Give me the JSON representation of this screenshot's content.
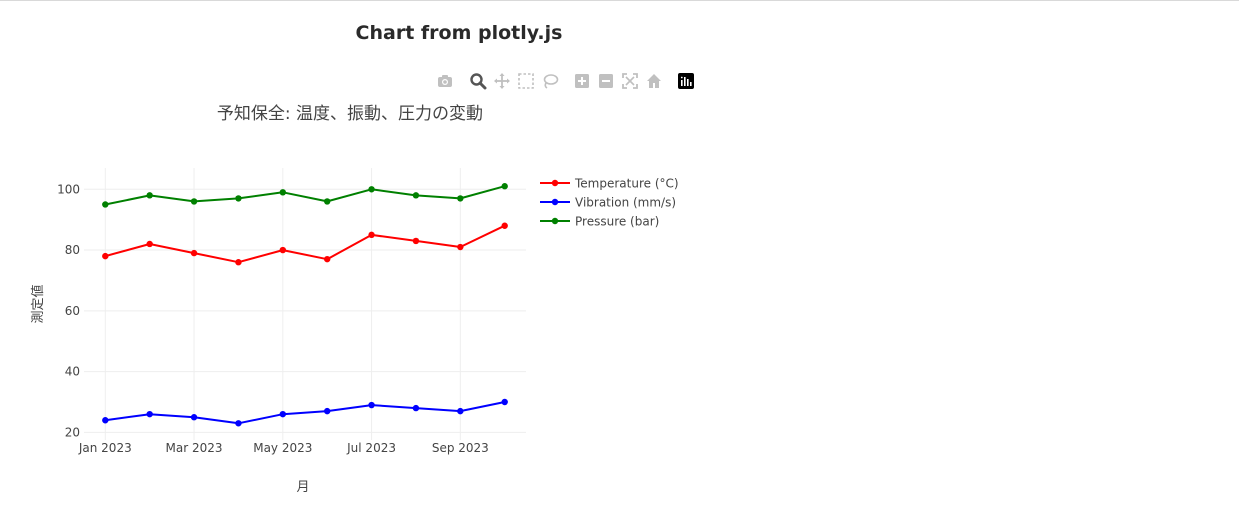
{
  "page": {
    "title": "Chart from plotly.js"
  },
  "modebar": {
    "icons": [
      "camera-icon",
      "zoom-icon",
      "pan-icon",
      "box-select-icon",
      "lasso-select-icon",
      "zoom-in-icon",
      "zoom-out-icon",
      "autoscale-icon",
      "reset-axes-icon",
      "plotly-logo-icon"
    ]
  },
  "chart_data": {
    "type": "line",
    "title": "予知保全: 温度、振動、圧力の変動",
    "xlabel": "月",
    "ylabel": "測定値",
    "x": [
      "2023-01",
      "2023-02",
      "2023-03",
      "2023-04",
      "2023-05",
      "2023-06",
      "2023-07",
      "2023-08",
      "2023-09",
      "2023-10"
    ],
    "x_tick_labels": [
      "Jan 2023",
      "Mar 2023",
      "May 2023",
      "Jul 2023",
      "Sep 2023"
    ],
    "y_tick_labels": [
      "20",
      "40",
      "60",
      "80",
      "100"
    ],
    "y_ticks": [
      20,
      40,
      60,
      80,
      100
    ],
    "ylim": [
      17.5,
      107
    ],
    "grid": true,
    "legend_position": "right",
    "series": [
      {
        "name": "Temperature (°C)",
        "color": "#ff0000",
        "values": [
          78,
          82,
          79,
          76,
          80,
          77,
          85,
          83,
          81,
          88
        ]
      },
      {
        "name": "Vibration (mm/s)",
        "color": "#0000ff",
        "values": [
          24,
          26,
          25,
          23,
          26,
          27,
          29,
          28,
          27,
          30
        ]
      },
      {
        "name": "Pressure (bar)",
        "color": "#008000",
        "values": [
          95,
          98,
          96,
          97,
          99,
          96,
          100,
          98,
          97,
          101
        ]
      }
    ]
  }
}
